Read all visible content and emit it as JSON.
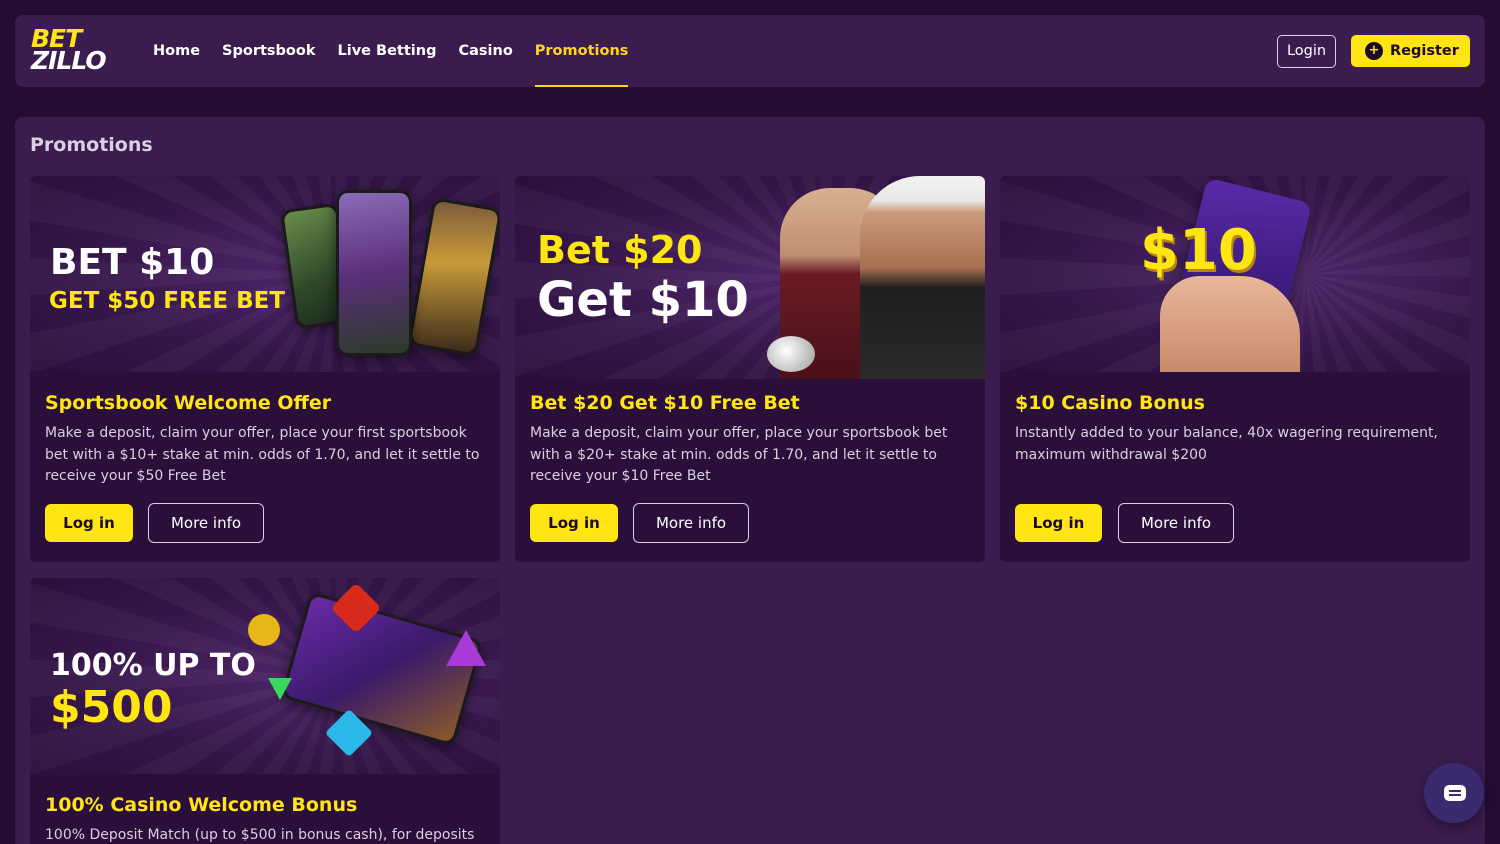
{
  "brand": {
    "logo_line1": "BET",
    "logo_line2": "ZILLO"
  },
  "nav": {
    "items": [
      {
        "label": "Home"
      },
      {
        "label": "Sportsbook"
      },
      {
        "label": "Live Betting"
      },
      {
        "label": "Casino"
      },
      {
        "label": "Promotions"
      }
    ],
    "active": "Promotions"
  },
  "header": {
    "login_label": "Login",
    "register_label": "Register"
  },
  "page": {
    "title": "Promotions"
  },
  "cards": [
    {
      "banner_line1": "BET $10",
      "banner_line2": "GET $50 FREE BET",
      "title": "Sportsbook Welcome Offer",
      "description": "Make a deposit, claim your offer, place your first sportsbook bet with a $10+ stake at min. odds of 1.70, and let it settle to receive your $50 Free Bet",
      "login_label": "Log in",
      "more_label": "More info"
    },
    {
      "banner_line1": "Bet $20",
      "banner_line2": "Get $10",
      "title": "Bet $20 Get $10 Free Bet",
      "description": "Make a deposit, claim your offer, place your sportsbook bet with a $20+ stake at min. odds of 1.70, and let it settle to receive your $10 Free Bet",
      "login_label": "Log in",
      "more_label": "More info"
    },
    {
      "banner_line1": "$10",
      "title": "$10 Casino Bonus",
      "description": "Instantly added to your balance, 40x wagering requirement, maximum withdrawal $200",
      "login_label": "Log in",
      "more_label": "More info"
    },
    {
      "banner_line1": "100% UP TO",
      "banner_line2": "$500",
      "title": "100% Casino Welcome Bonus",
      "description": "100% Deposit Match (up to $500 in bonus cash), for deposits"
    }
  ],
  "colors": {
    "accent": "#ffe512",
    "background": "#240c33",
    "panel": "#3a1c4f",
    "card": "#2a0f3b"
  },
  "icons": {
    "register": "plus-circle-icon",
    "chat": "chat-bubble-icon"
  }
}
